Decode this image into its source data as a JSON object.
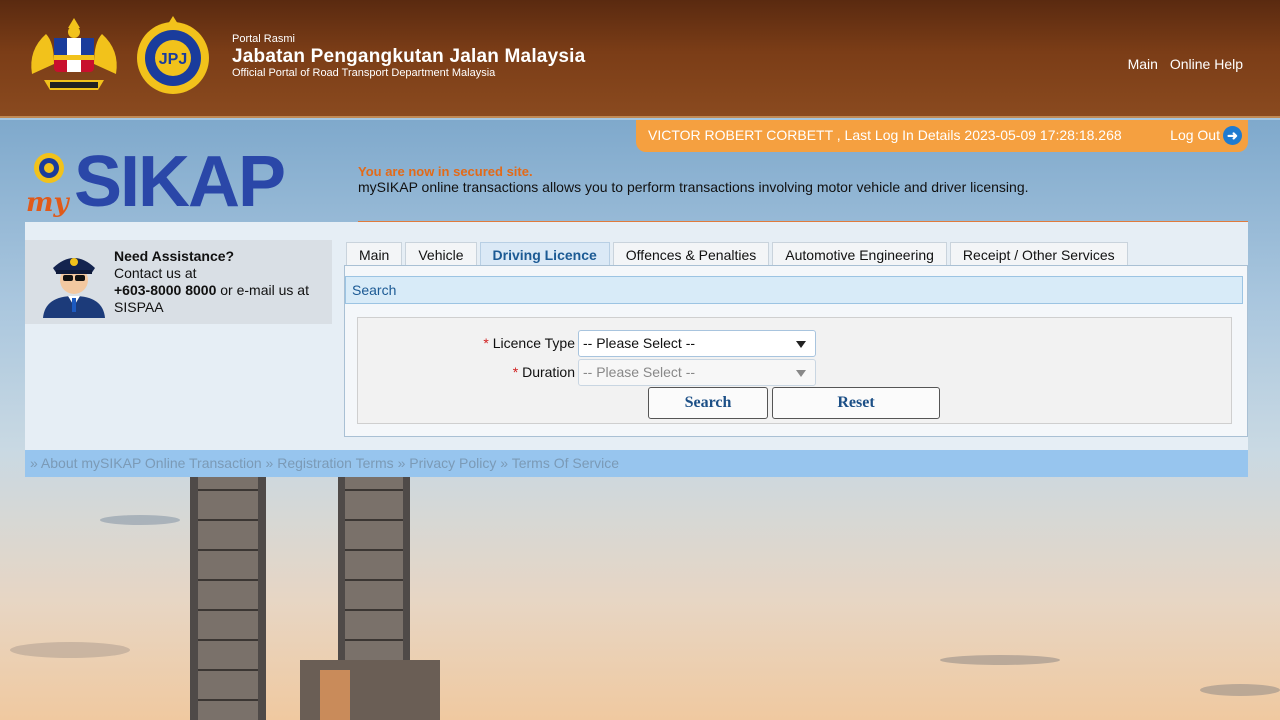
{
  "header": {
    "portal_small": "Portal Rasmi",
    "portal_title": "Jabatan Pengangkutan Jalan Malaysia",
    "portal_subtitle": "Official Portal of Road Transport Department Malaysia",
    "links": [
      "Main",
      "Online Help"
    ]
  },
  "user_bar": {
    "text": "VICTOR ROBERT CORBETT , Last Log In Details 2023-05-09 17:28:18.268",
    "logout": "Log Out",
    "logout_icon": "arrow-right-circle-icon"
  },
  "brand": {
    "name": "SIKAP",
    "prefix": "my"
  },
  "secure": {
    "title": "You are now in secured site.",
    "description": "mySIKAP online transactions allows you to perform transactions involving motor vehicle and driver licensing."
  },
  "assist": {
    "title": "Need Assistance?",
    "line1": "Contact us at",
    "phone": "+603-8000 8000",
    "line2": " or e-mail us at",
    "line3": "SISPAA"
  },
  "tabs": [
    "Main",
    "Vehicle",
    "Driving Licence",
    "Offences & Penalties",
    "Automotive Engineering",
    "Receipt / Other Services"
  ],
  "active_tab": "Driving Licence",
  "search": {
    "title": "Search",
    "licence_label": "Licence Type",
    "licence_value": "-- Please Select --",
    "duration_label": "Duration",
    "duration_value": "-- Please Select --",
    "required_mark": "*",
    "search_button": "Search",
    "reset_button": "Reset"
  },
  "footer": {
    "links": [
      "» About mySIKAP Online Transaction",
      "» Registration Terms",
      "» Privacy Policy",
      "» Terms Of Service"
    ]
  },
  "colors": {
    "header_brown": "#7b3d17",
    "user_bar_orange": "#f5a040",
    "brand_blue": "#2a47a8",
    "secure_orange": "#e36a18",
    "footer_blue": "#97c5ee"
  }
}
